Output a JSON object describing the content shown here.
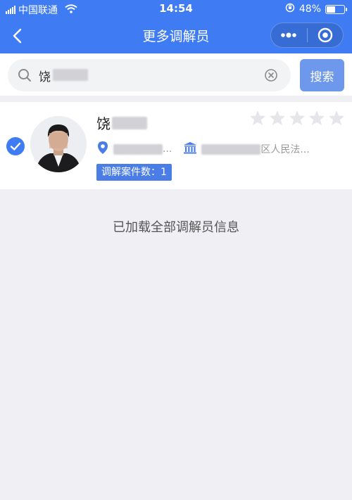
{
  "status_bar": {
    "carrier": "中国联通",
    "time": "14:54",
    "battery_percent": "48%",
    "battery_level": 0.48
  },
  "nav": {
    "title": "更多调解员"
  },
  "search": {
    "value": "饶",
    "button_label": "搜索"
  },
  "mediator": {
    "name": "饶",
    "location_suffix": "...",
    "court_suffix": "区人民法...",
    "case_count_label": "调解案件数：",
    "case_count_value": "1",
    "rating_stars": 0,
    "selected": true
  },
  "list": {
    "end_message": "已加载全部调解员信息"
  },
  "colors": {
    "header_blue": "#3f7cf3",
    "search_button": "#6d98ec",
    "badge_blue": "#4a7ee6",
    "background": "#efeff4"
  }
}
